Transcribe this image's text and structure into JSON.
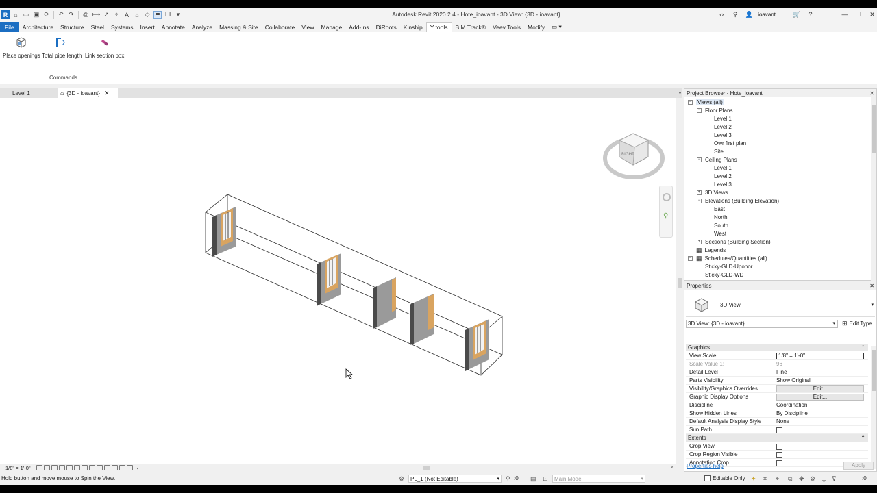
{
  "window": {
    "title": "Autodesk Revit 2020.2.4 - Hote_ioavant - 3D View: {3D - ioavant}",
    "user": "ioavant"
  },
  "ribbon": {
    "tabs": [
      "File",
      "Architecture",
      "Structure",
      "Steel",
      "Systems",
      "Insert",
      "Annotate",
      "Analyze",
      "Massing & Site",
      "Collaborate",
      "View",
      "Manage",
      "Add-Ins",
      "DiRoots",
      "Kinship",
      "Y tools",
      "BIM Track®",
      "Veev Tools",
      "Modify"
    ],
    "active_tab": "Y tools",
    "commands": [
      "Place openings",
      "Total pipe length",
      "Link section box"
    ],
    "panel_title": "Commands"
  },
  "view_tabs": [
    {
      "label": "Level 1"
    },
    {
      "label": "{3D - ioavant}"
    }
  ],
  "viewcube": {
    "face": "RIGHT"
  },
  "view_control": {
    "scale": "1/8\" = 1'-0\""
  },
  "project_browser": {
    "title": "Project Browser - Hote_ioavant",
    "rows": [
      {
        "label": "Views (all)",
        "depth": 0,
        "toggle": "−"
      },
      {
        "label": "Floor Plans",
        "depth": 1,
        "toggle": "−"
      },
      {
        "label": "Level 1",
        "depth": 2,
        "toggle": ""
      },
      {
        "label": "Level 2",
        "depth": 2,
        "toggle": ""
      },
      {
        "label": "Level 3",
        "depth": 2,
        "toggle": ""
      },
      {
        "label": "Owr first plan",
        "depth": 2,
        "toggle": ""
      },
      {
        "label": "Site",
        "depth": 2,
        "toggle": ""
      },
      {
        "label": "Ceiling Plans",
        "depth": 1,
        "toggle": "−"
      },
      {
        "label": "Level 1",
        "depth": 2,
        "toggle": ""
      },
      {
        "label": "Level 2",
        "depth": 2,
        "toggle": ""
      },
      {
        "label": "Level 3",
        "depth": 2,
        "toggle": ""
      },
      {
        "label": "3D Views",
        "depth": 1,
        "toggle": "+"
      },
      {
        "label": "Elevations (Building Elevation)",
        "depth": 1,
        "toggle": "−"
      },
      {
        "label": "East",
        "depth": 2,
        "toggle": ""
      },
      {
        "label": "North",
        "depth": 2,
        "toggle": ""
      },
      {
        "label": "South",
        "depth": 2,
        "toggle": ""
      },
      {
        "label": "West",
        "depth": 2,
        "toggle": ""
      },
      {
        "label": "Sections (Building Section)",
        "depth": 1,
        "toggle": "+"
      },
      {
        "label": "Legends",
        "depth": 0,
        "toggle": ""
      },
      {
        "label": "Schedules/Quantities (all)",
        "depth": 0,
        "toggle": "−"
      },
      {
        "label": "Sticky-GLD-Uponor",
        "depth": 1,
        "toggle": ""
      },
      {
        "label": "Sticky-GLD-WD",
        "depth": 1,
        "toggle": ""
      }
    ]
  },
  "properties": {
    "title": "Properties",
    "type_name": "3D View",
    "instance_selector": "3D View: {3D - ioavant}",
    "edit_type": "Edit Type",
    "groups": [
      {
        "name": "Graphics",
        "rows": [
          {
            "key": "View Scale",
            "value": "1/8\" = 1'-0\"",
            "kind": "input"
          },
          {
            "key": "Scale Value    1:",
            "value": "96",
            "kind": "disabled"
          },
          {
            "key": "Detail Level",
            "value": "Fine",
            "kind": "text"
          },
          {
            "key": "Parts Visibility",
            "value": "Show Original",
            "kind": "text"
          },
          {
            "key": "Visibility/Graphics Overrides",
            "value": "Edit...",
            "kind": "button"
          },
          {
            "key": "Graphic Display Options",
            "value": "Edit...",
            "kind": "button"
          },
          {
            "key": "Discipline",
            "value": "Coordination",
            "kind": "text"
          },
          {
            "key": "Show Hidden Lines",
            "value": "By Discipline",
            "kind": "text"
          },
          {
            "key": "Default Analysis Display Style",
            "value": "None",
            "kind": "text"
          },
          {
            "key": "Sun Path",
            "value": "",
            "kind": "checkbox"
          }
        ]
      },
      {
        "name": "Extents",
        "rows": [
          {
            "key": "Crop View",
            "value": "",
            "kind": "checkbox"
          },
          {
            "key": "Crop Region Visible",
            "value": "",
            "kind": "checkbox"
          },
          {
            "key": "Annotation Crop",
            "value": "",
            "kind": "checkbox"
          }
        ]
      }
    ],
    "help_link": "Properties help",
    "apply": "Apply"
  },
  "status_bar": {
    "message": "Hold button and move mouse to Spin the View.",
    "workset": "PL_1 (Not Editable)",
    "workset_count": ":0",
    "design_option": "Main Model",
    "editable_only": "Editable Only",
    "filter_count": ":0"
  },
  "colors": {
    "accent": "#1b6ec2",
    "door_wood": "#d9a460",
    "wall": "#7a7a7a"
  }
}
